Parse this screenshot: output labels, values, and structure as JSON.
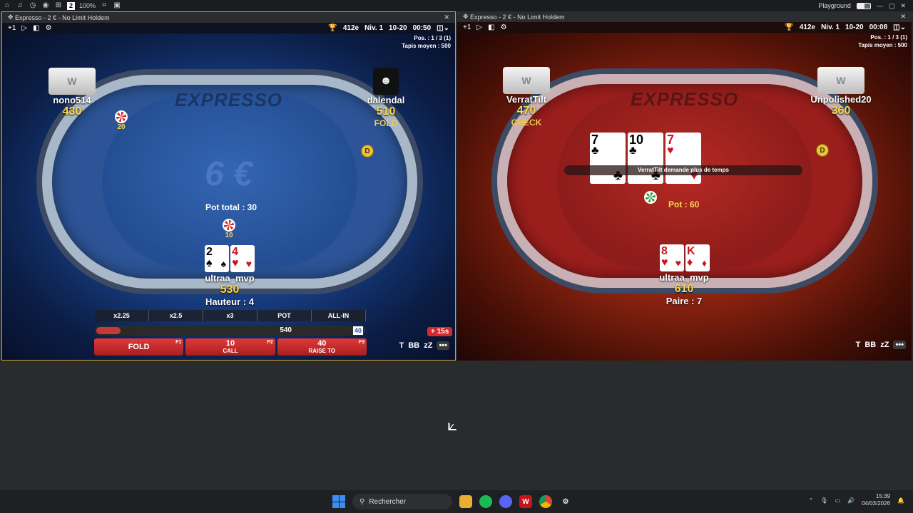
{
  "topbar": {
    "icons": [
      "home-icon",
      "bell-icon",
      "clock-icon",
      "eye-icon",
      "grid-icon",
      "crop-icon",
      "window-icon"
    ],
    "badge": "2",
    "zoom": "100%",
    "playground": "Playground",
    "controls": [
      "—",
      "▢",
      "✕"
    ]
  },
  "left_table": {
    "title": "Expresso - 2 € - No Limit Holdem",
    "plus": "+1",
    "prize": "412e",
    "level": "Niv. 1",
    "blinds": "10-20",
    "timer": "00:50",
    "position": "Pos. : 1 / 3 (1)",
    "avg_stack": "Tapis moyen : 500",
    "brand": "EXPRESSO",
    "buyin_display": "6 €",
    "seats": {
      "top_left": {
        "name": "nono514",
        "stack": "430",
        "bet": "20"
      },
      "top_right": {
        "name": "dalendal",
        "stack": "510",
        "action": "FOLD"
      },
      "hero": {
        "name": "ultraa_mvp",
        "stack": "530",
        "hand": "Hauteur : 4",
        "bet": "10"
      }
    },
    "hero_cards": [
      {
        "rank": "2",
        "suit": "♠",
        "color": "black"
      },
      {
        "rank": "4",
        "suit": "♥",
        "color": "red"
      }
    ],
    "pot": "Pot total : 30",
    "dealer": "D",
    "bet_sizes": [
      "x2.25",
      "x2.5",
      "x3",
      "POT",
      "ALL-IN"
    ],
    "slider": {
      "max": "540",
      "current": "40",
      "fill": 0.09
    },
    "timebank": "+ 15s",
    "actions": {
      "fold": {
        "label": "FOLD",
        "key": "F1"
      },
      "call": {
        "amount": "10",
        "label": "CALL",
        "key": "F2"
      },
      "raise": {
        "amount": "40",
        "label": "RAISE TO",
        "key": "F3"
      }
    },
    "tools": [
      "T",
      "BB",
      "zZ",
      "•••"
    ]
  },
  "right_table": {
    "title": "Expresso - 2 € - No Limit Holdem",
    "plus": "+1",
    "prize": "412e",
    "level": "Niv. 1",
    "blinds": "10-20",
    "timer": "00:08",
    "position": "Pos. : 1 / 3 (1)",
    "avg_stack": "Tapis moyen : 500",
    "brand": "EXPRESSO",
    "seats": {
      "top_left": {
        "name": "VerratTilt",
        "stack": "470",
        "action": "CHECK"
      },
      "top_right": {
        "name": "Unpolished20",
        "stack": "360"
      },
      "hero": {
        "name": "ultraa_mvp",
        "stack": "610",
        "hand": "Paire : 7"
      }
    },
    "board": [
      {
        "rank": "7",
        "suit": "♣",
        "color": "black"
      },
      {
        "rank": "10",
        "suit": "♣",
        "color": "black"
      },
      {
        "rank": "7",
        "suit": "♥",
        "color": "red"
      }
    ],
    "hero_cards": [
      {
        "rank": "8",
        "suit": "♥",
        "color": "red"
      },
      {
        "rank": "K",
        "suit": "♦",
        "color": "red"
      }
    ],
    "banner": "VerratTilt demande plus de temps",
    "pot": "Pot : 60",
    "dealer": "D",
    "tools": [
      "T",
      "BB",
      "zZ",
      "•••"
    ]
  },
  "taskbar": {
    "search_label": "Rechercher",
    "apps": [
      "folder-icon",
      "spotify-icon",
      "discord-icon",
      "winamax-icon",
      "chrome-icon",
      "settings-icon"
    ],
    "time": "15:39",
    "date": "04/03/2026"
  }
}
